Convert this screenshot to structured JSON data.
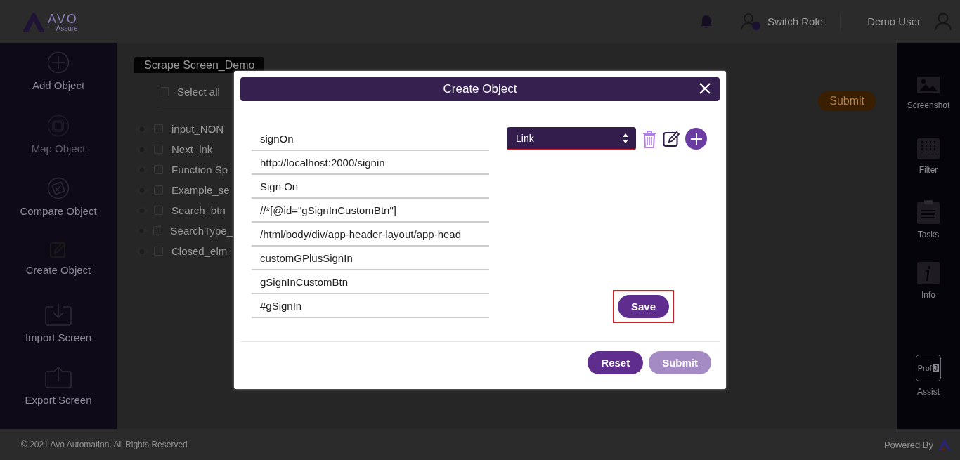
{
  "header": {
    "logo": {
      "name": "AVO",
      "tagline": "Assure"
    },
    "switch_role": "Switch Role",
    "user": "Demo User"
  },
  "left_sidebar": {
    "items": [
      {
        "label": "Add Object",
        "disabled": false
      },
      {
        "label": "Map Object",
        "disabled": true
      },
      {
        "label": "Compare Object",
        "disabled": false
      },
      {
        "label": "Create Object",
        "disabled": false
      },
      {
        "label": "Import Screen",
        "disabled": false
      },
      {
        "label": "Export Screen",
        "disabled": false
      }
    ]
  },
  "screen": {
    "title": "Scrape Screen_Demo",
    "select_all": {
      "label": "Select all",
      "checked": false
    },
    "objects": [
      {
        "name": "input_NON",
        "checked": false
      },
      {
        "name": "Next_lnk",
        "checked": false
      },
      {
        "name": "Function Sp",
        "checked": false
      },
      {
        "name": "Example_se",
        "checked": false
      },
      {
        "name": "Search_btn",
        "checked": false
      },
      {
        "name": "SearchType_",
        "checked": false
      },
      {
        "name": "Closed_elm",
        "checked": false
      }
    ],
    "submit": "Submit"
  },
  "right_sidebar": {
    "items": [
      {
        "label": "Screenshot"
      },
      {
        "label": "Filter"
      },
      {
        "label": "Tasks"
      },
      {
        "label": "Info"
      }
    ],
    "assist": {
      "label": "Assist",
      "badge": "Prof",
      "badge_mark": "J"
    }
  },
  "modal": {
    "title": "Create Object",
    "fields": [
      {
        "value": "signOn"
      },
      {
        "value": "http://localhost:2000/signin"
      },
      {
        "value": "Sign On"
      },
      {
        "value": "//*[@id=\"gSignInCustomBtn\"]"
      },
      {
        "value": "/html/body/div/app-header-layout/app-head"
      },
      {
        "value": "customGPlusSignIn"
      },
      {
        "value": "gSignInCustomBtn"
      },
      {
        "value": "#gSignIn"
      }
    ],
    "type_select": {
      "value": "Link"
    },
    "save": {
      "label": "Save",
      "highlighted": true
    },
    "reset": "Reset",
    "submit": {
      "label": "Submit",
      "disabled": true
    }
  },
  "footer": {
    "copyright": "© 2021 Avo Automation. All Rights Reserved",
    "powered_by": "Powered By"
  }
}
